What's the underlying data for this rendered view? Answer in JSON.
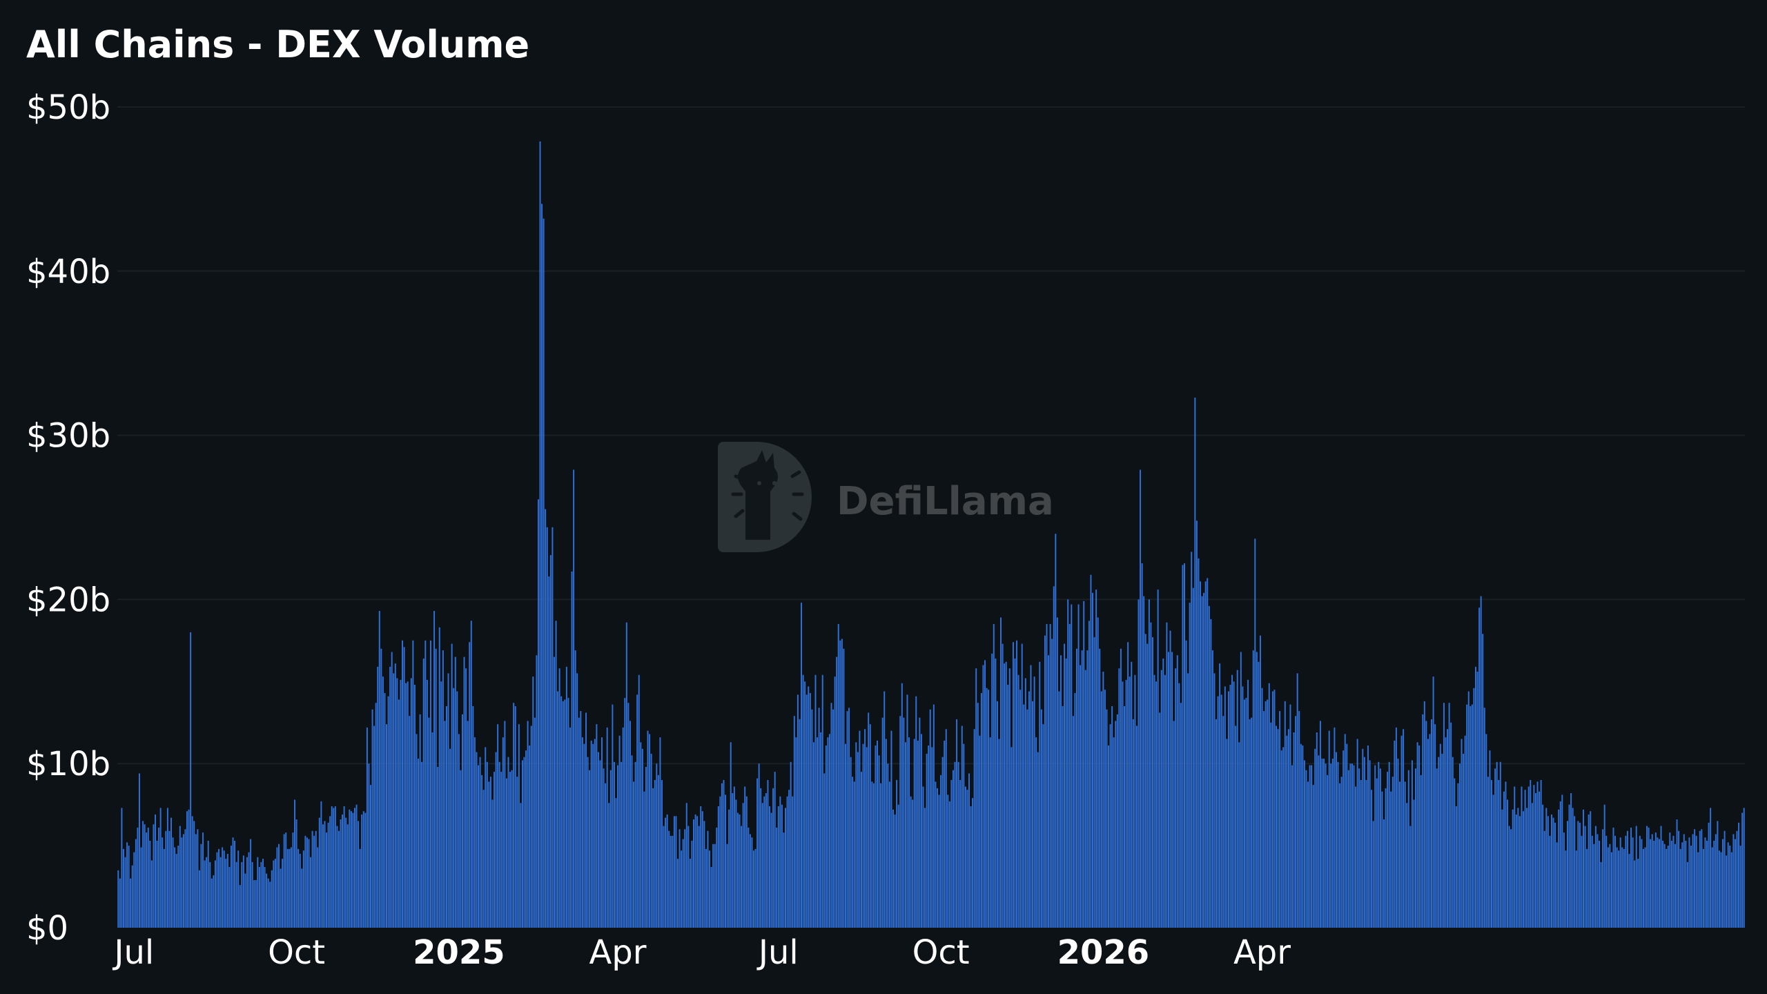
{
  "chart_data": {
    "type": "bar",
    "title": "All Chains - DEX Volume",
    "unit": "USD (billions)",
    "ylim": [
      0,
      50
    ],
    "yticks": [
      {
        "value": 0,
        "label": "$0"
      },
      {
        "value": 10,
        "label": "$10b"
      },
      {
        "value": 20,
        "label": "$20b"
      },
      {
        "value": 30,
        "label": "$30b"
      },
      {
        "value": 40,
        "label": "$40b"
      },
      {
        "value": 50,
        "label": "$50b"
      }
    ],
    "xticks": [
      {
        "date": "2024-07-01",
        "label": "Jul",
        "bold": false
      },
      {
        "date": "2024-10-01",
        "label": "Oct",
        "bold": false
      },
      {
        "date": "2025-01-01",
        "label": "2025",
        "bold": true
      },
      {
        "date": "2025-04-01",
        "label": "Apr",
        "bold": false
      },
      {
        "date": "2025-07-01",
        "label": "Jul",
        "bold": false
      },
      {
        "date": "2025-10-01",
        "label": "Oct",
        "bold": false
      },
      {
        "date": "2026-01-01",
        "label": "2026",
        "bold": true
      },
      {
        "date": "2026-04-01",
        "label": "Apr",
        "bold": false
      }
    ],
    "grid": true,
    "legend": "none",
    "bar_color": "#2f6fd6",
    "start_date": "2024-06-22",
    "frequency": "daily",
    "values_billion_usd": [
      3.5,
      3.0,
      7.3,
      4.8,
      4.3,
      5.2,
      5.0,
      3.0,
      3.8,
      4.6,
      5.4,
      6.1,
      9.4,
      4.9,
      6.5,
      6.3,
      5.8,
      6.1,
      5.3,
      4.1,
      6.3,
      6.9,
      5.3,
      6.1,
      7.3,
      5.5,
      4.8,
      5.9,
      7.3,
      5.9,
      6.7,
      5.5,
      4.9,
      4.5,
      5.0,
      6.2,
      5.5,
      5.7,
      6.0,
      7.1,
      7.2,
      18.0,
      6.8,
      6.5,
      5.7,
      6.0,
      3.5,
      5.1,
      5.8,
      4.1,
      4.3,
      5.3,
      4.0,
      3.0,
      3.2,
      4.1,
      4.6,
      4.8,
      4.3,
      4.9,
      4.7,
      4.2,
      4.5,
      3.7,
      5.0,
      5.5,
      5.3,
      4.0,
      4.7,
      2.6,
      4.0,
      4.4,
      3.3,
      4.3,
      4.6,
      5.4,
      4.0,
      2.9,
      2.9,
      4.3,
      3.7,
      4.0,
      4.2,
      3.7,
      3.3,
      3.0,
      2.8,
      3.5,
      4.1,
      4.2,
      4.9,
      5.1,
      3.6,
      4.2,
      5.7,
      5.8,
      4.8,
      4.8,
      4.9,
      5.8,
      7.8,
      6.6,
      4.8,
      4.5,
      3.6,
      4.7,
      5.6,
      5.5,
      5.4,
      4.3,
      5.9,
      5.6,
      5.9,
      4.9,
      6.7,
      7.7,
      6.3,
      6.5,
      5.8,
      6.4,
      6.8,
      7.4,
      7.3,
      7.4,
      6.2,
      5.9,
      6.6,
      6.9,
      7.4,
      6.7,
      6.3,
      7.2,
      7.1,
      7.0,
      7.3,
      7.5,
      6.5,
      4.8,
      6.9,
      7.1,
      7.0,
      12.2,
      10.0,
      8.7,
      13.3,
      12.3,
      13.7,
      15.9,
      19.3,
      17.0,
      15.3,
      14.3,
      12.4,
      14.1,
      15.9,
      16.8,
      15.5,
      16.1,
      15.2,
      13.9,
      15.1,
      17.5,
      17.1,
      14.9,
      15.0,
      12.9,
      15.2,
      17.5,
      14.8,
      11.8,
      10.3,
      13.0,
      10.1,
      16.4,
      17.5,
      15.1,
      12.8,
      17.5,
      11.9,
      19.3,
      17.0,
      9.8,
      18.3,
      15.0,
      16.9,
      12.6,
      13.5,
      15.5,
      10.9,
      17.3,
      14.6,
      16.5,
      14.4,
      11.8,
      9.6,
      13.0,
      16.5,
      15.8,
      12.6,
      17.4,
      18.7,
      13.5,
      11.6,
      10.7,
      9.9,
      10.4,
      9.3,
      8.4,
      11.0,
      10.1,
      8.9,
      9.2,
      7.8,
      9.5,
      10.7,
      12.4,
      10.1,
      9.5,
      11.6,
      12.6,
      9.1,
      10.4,
      9.5,
      9.6,
      13.7,
      13.5,
      9.2,
      12.4,
      7.6,
      10.2,
      10.4,
      10.8,
      12.6,
      11.1,
      12.3,
      15.3,
      12.8,
      16.6,
      26.1,
      47.9,
      44.1,
      43.2,
      25.5,
      24.4,
      21.4,
      22.7,
      24.4,
      16.5,
      18.7,
      14.4,
      15.8,
      14.1,
      13.8,
      13.9,
      15.9,
      14.0,
      12.2,
      21.7,
      27.9,
      16.9,
      15.5,
      12.8,
      13.2,
      11.6,
      11.2,
      13.1,
      10.4,
      9.6,
      11.4,
      11.2,
      11.5,
      12.4,
      10.7,
      10.2,
      11.6,
      9.7,
      8.8,
      12.2,
      7.6,
      9.6,
      13.6,
      10.1,
      7.9,
      9.9,
      11.7,
      10.1,
      12.2,
      14.0,
      18.6,
      13.7,
      12.6,
      10.5,
      8.9,
      10.1,
      14.2,
      15.4,
      11.3,
      10.9,
      8.3,
      9.8,
      12.0,
      11.8,
      10.6,
      8.5,
      9.0,
      10.0,
      9.3,
      11.6,
      9.0,
      6.2,
      6.7,
      6.9,
      5.9,
      5.6,
      5.6,
      6.8,
      6.8,
      4.2,
      6.0,
      4.7,
      5.4,
      6.0,
      7.6,
      6.2,
      4.2,
      5.3,
      6.6,
      6.9,
      6.8,
      6.2,
      7.4,
      7.1,
      6.5,
      4.8,
      5.9,
      4.7,
      3.7,
      5.1,
      5.1,
      6.1,
      7.4,
      8.0,
      8.8,
      9.0,
      8.1,
      5.1,
      7.2,
      11.3,
      8.2,
      8.6,
      7.8,
      7.0,
      6.9,
      6.2,
      7.6,
      8.6,
      8.0,
      6.1,
      5.7,
      5.5,
      4.7,
      4.8,
      9.1,
      10.0,
      8.5,
      7.6,
      8.0,
      8.2,
      9.0,
      7.4,
      7.0,
      8.5,
      9.5,
      6.1,
      7.4,
      8.0,
      7.5,
      5.8,
      7.3,
      8.0,
      8.4,
      10.1,
      8.0,
      12.9,
      11.6,
      14.2,
      12.7,
      19.8,
      15.4,
      15.0,
      14.2,
      14.7,
      14.3,
      13.3,
      11.3,
      15.4,
      11.6,
      13.4,
      11.9,
      15.4,
      9.4,
      11.1,
      11.6,
      11.8,
      13.7,
      13.3,
      15.3,
      16.5,
      18.5,
      17.5,
      17.6,
      17.0,
      11.2,
      13.2,
      13.4,
      10.4,
      9.2,
      8.9,
      11.3,
      10.7,
      12.0,
      9.5,
      11.2,
      12.1,
      11.0,
      13.1,
      12.4,
      8.9,
      8.8,
      11.1,
      11.4,
      10.5,
      8.8,
      12.8,
      14.4,
      11.5,
      10.0,
      8.9,
      12.0,
      7.2,
      6.9,
      9.0,
      7.5,
      12.9,
      14.9,
      12.8,
      11.3,
      14.2,
      11.6,
      8.0,
      7.8,
      11.5,
      14.1,
      11.4,
      12.8,
      11.8,
      8.6,
      7.3,
      10.6,
      11.1,
      13.3,
      11.0,
      13.6,
      8.9,
      8.5,
      8.1,
      9.3,
      10.4,
      11.4,
      12.1,
      8.1,
      7.7,
      9.0,
      9.6,
      10.1,
      12.7,
      10.1,
      9.0,
      12.3,
      11.2,
      8.6,
      8.4,
      9.4,
      7.4,
      7.9,
      12.1,
      15.8,
      13.7,
      11.7,
      14.3,
      16.0,
      16.3,
      14.6,
      14.5,
      11.6,
      16.7,
      18.5,
      16.4,
      13.8,
      11.5,
      18.9,
      17.3,
      16.1,
      16.2,
      14.8,
      15.8,
      11.0,
      17.4,
      16.4,
      17.5,
      15.4,
      14.5,
      17.3,
      13.6,
      15.2,
      13.3,
      14.4,
      16.0,
      13.8,
      15.3,
      11.6,
      10.7,
      16.2,
      13.3,
      12.4,
      17.8,
      18.5,
      16.6,
      18.5,
      17.6,
      20.8,
      24.0,
      18.9,
      14.4,
      16.6,
      13.5,
      17.3,
      16.4,
      20.0,
      18.5,
      19.7,
      12.9,
      14.3,
      17.0,
      19.7,
      16.0,
      16.9,
      19.9,
      15.7,
      16.9,
      18.7,
      21.5,
      20.4,
      17.7,
      20.6,
      18.9,
      17.0,
      14.4,
      15.6,
      14.5,
      13.3,
      11.1,
      12.4,
      13.5,
      11.6,
      12.6,
      13.0,
      15.8,
      17.0,
      15.0,
      13.5,
      15.1,
      17.4,
      15.3,
      16.2,
      12.7,
      15.4,
      12.3,
      20.0,
      27.9,
      22.2,
      20.2,
      17.9,
      17.3,
      20.0,
      18.6,
      17.7,
      15.4,
      15.0,
      20.6,
      13.1,
      15.7,
      16.4,
      15.4,
      18.6,
      16.8,
      18.1,
      16.8,
      12.6,
      15.8,
      16.6,
      14.9,
      13.7,
      22.1,
      22.2,
      17.5,
      15.5,
      19.8,
      22.9,
      20.7,
      32.3,
      24.8,
      22.5,
      21.1,
      20.2,
      20.4,
      21.1,
      21.3,
      19.6,
      18.8,
      16.9,
      15.5,
      12.7,
      14.1,
      16.1,
      14.2,
      12.9,
      14.7,
      11.5,
      14.4,
      14.8,
      15.4,
      15.0,
      12.3,
      15.7,
      11.3,
      16.8,
      14.7,
      13.9,
      14.0,
      15.1,
      12.7,
      12.8,
      16.9,
      23.7,
      16.8,
      16.2,
      17.8,
      14.6,
      13.2,
      13.8,
      13.9,
      14.9,
      12.5,
      14.4,
      14.5,
      12.3,
      12.1,
      13.2,
      10.8,
      11.0,
      13.8,
      11.7,
      12.1,
      13.6,
      9.9,
      11.9,
      12.9,
      15.5,
      13.2,
      11.2,
      11.1,
      10.2,
      9.6,
      8.9,
      9.9,
      9.9,
      8.7,
      10.9,
      11.9,
      10.5,
      12.6,
      10.3,
      10.3,
      10.0,
      9.3,
      12.0,
      10.0,
      10.3,
      12.2,
      10.7,
      10.1,
      8.8,
      9.2,
      10.8,
      11.8,
      11.2,
      9.6,
      10.0,
      10.0,
      9.9,
      8.6,
      11.5,
      9.7,
      9.0,
      10.9,
      10.4,
      9.0,
      11.1,
      10.2,
      8.4,
      6.5,
      9.9,
      9.1,
      10.1,
      9.7,
      8.3,
      6.6,
      8.5,
      9.5,
      10.1,
      8.3,
      9.2,
      11.4,
      12.2,
      10.3,
      8.9,
      11.7,
      12.1,
      8.9,
      7.6,
      9.6,
      6.2,
      10.2,
      7.8,
      9.7,
      11.3,
      11.1,
      9.3,
      13.0,
      13.8,
      12.6,
      11.5,
      11.8,
      12.7,
      15.3,
      12.4,
      9.7,
      10.4,
      11.2,
      10.6,
      13.7,
      11.6,
      12.1,
      13.7,
      12.5,
      10.4,
      9.1,
      7.4,
      8.8,
      10.0,
      11.5,
      10.6,
      11.7,
      13.6,
      14.4,
      13.5,
      13.6,
      14.6,
      15.9,
      15.6,
      19.5,
      20.2,
      17.9,
      13.4,
      11.8,
      9.2,
      10.8,
      9.0,
      8.1,
      9.7,
      10.1,
      9.0,
      10.1,
      7.2,
      8.3,
      8.9,
      7.8,
      6.2,
      6.0,
      7.2,
      8.6,
      6.9,
      7.3,
      6.8,
      8.6,
      7.1,
      8.4,
      7.3,
      8.6,
      9.0,
      7.6,
      8.7,
      8.2,
      8.9,
      8.3,
      9.0,
      7.5,
      5.9,
      7.3,
      6.8,
      5.6,
      6.9,
      6.7,
      6.4,
      5.2,
      7.2,
      7.7,
      8.1,
      5.8,
      4.7,
      6.5,
      7.5,
      8.2,
      7.3,
      6.8,
      4.7,
      6.5,
      6.4,
      5.6,
      7.2,
      6.2,
      4.8,
      6.9,
      7.1,
      5.6,
      5.1,
      6.2,
      5.7,
      5.3,
      4.0,
      6.0,
      7.5,
      5.6,
      4.9,
      5.1,
      4.6,
      6.1,
      5.6,
      4.9,
      4.7,
      5.5,
      4.9,
      4.8,
      5.6,
      5.9,
      4.5,
      6.1,
      5.5,
      4.1,
      6.2,
      4.2,
      5.6,
      5.4,
      4.8,
      4.9,
      6.2,
      6.1,
      5.4,
      5.7,
      5.3,
      5.8,
      5.5,
      5.4,
      6.2,
      5.3,
      5.1,
      4.8,
      5.0,
      5.8,
      5.3,
      5.6,
      5.1,
      6.6,
      5.9,
      4.8,
      5.2,
      5.7,
      5.3,
      4.0,
      5.5,
      5.0,
      5.7,
      6.0,
      5.6,
      4.6,
      5.9,
      6.0,
      4.8,
      5.5,
      5.3,
      6.4,
      7.3,
      4.9,
      5.3,
      5.7,
      6.5,
      4.7,
      4.6,
      5.4,
      5.9,
      4.4,
      5.2,
      5.0,
      4.6,
      5.7,
      5.4,
      5.9,
      6.4,
      5.0,
      7.0,
      7.3
    ]
  },
  "watermark": {
    "text": "DefiLlama"
  }
}
